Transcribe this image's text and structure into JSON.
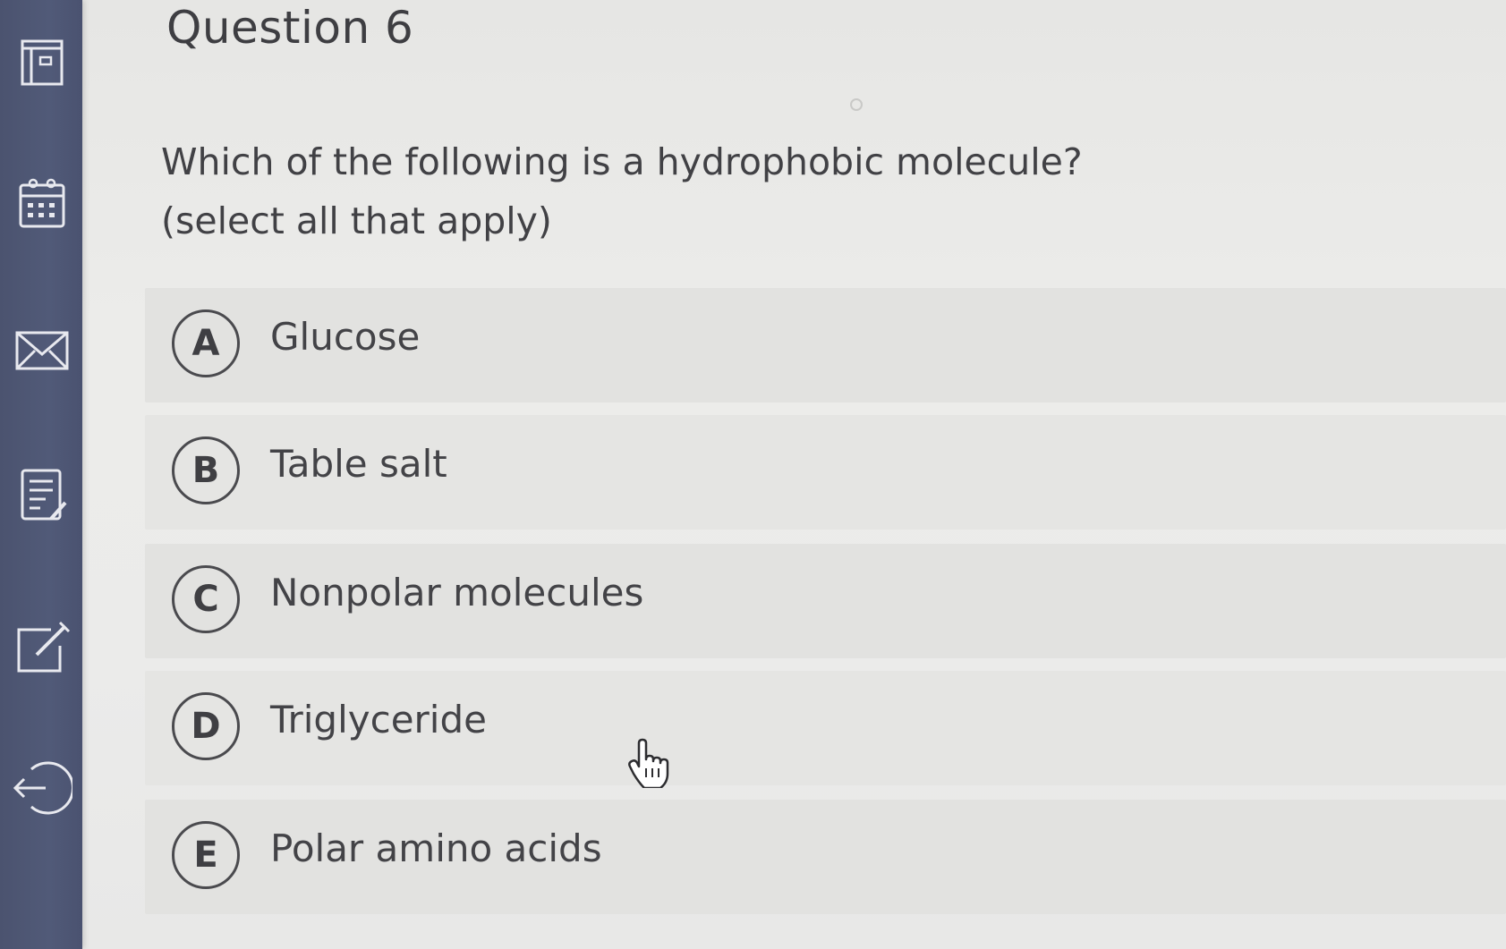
{
  "sidebar": {
    "items": [
      {
        "icon": "layout-icon",
        "name": "sidebar-item-layout"
      },
      {
        "icon": "calendar-icon",
        "name": "sidebar-item-calendar"
      },
      {
        "icon": "mail-icon",
        "name": "sidebar-item-mail"
      },
      {
        "icon": "notes-icon",
        "name": "sidebar-item-notes"
      },
      {
        "icon": "edit-icon",
        "name": "sidebar-item-edit"
      },
      {
        "icon": "logout-icon",
        "name": "sidebar-item-logout"
      }
    ]
  },
  "question": {
    "title": "Question 6",
    "prompt_line1": "Which of the following is a hydrophobic molecule?",
    "prompt_line2": "(select all that apply)"
  },
  "answers": [
    {
      "letter": "A",
      "label": "Glucose"
    },
    {
      "letter": "B",
      "label": "Table salt"
    },
    {
      "letter": "C",
      "label": "Nonpolar molecules"
    },
    {
      "letter": "D",
      "label": "Triglyceride"
    },
    {
      "letter": "E",
      "label": "Polar amino acids"
    }
  ],
  "colors": {
    "sidebar": "#4f5775",
    "background": "#e9e9e7",
    "text": "#414145"
  }
}
